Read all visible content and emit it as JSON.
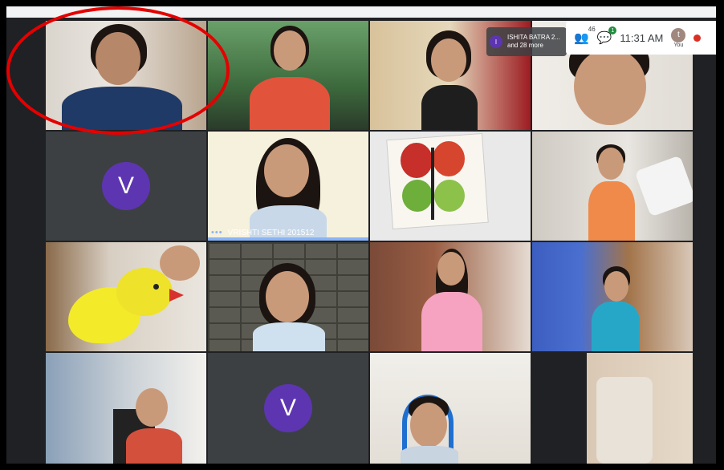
{
  "status": {
    "participants_count": "46",
    "chat_badge": "1",
    "time": "11:31 AM",
    "user_avatar_letter": "t",
    "user_label": "You"
  },
  "presenter_chip": {
    "avatar_letter": "I",
    "name": "ISHITA BATRA 2...",
    "more": "and 28 more"
  },
  "tiles": {
    "avatar_letter_1": "V",
    "avatar_letter_2": "V",
    "active_name": "VRISHTI SETHI 201512",
    "active_dots": "•••"
  },
  "colors": {
    "avatar": "#5d35b1",
    "active_speaker": "#8ab4f8",
    "highlight_circle": "#e50000"
  }
}
